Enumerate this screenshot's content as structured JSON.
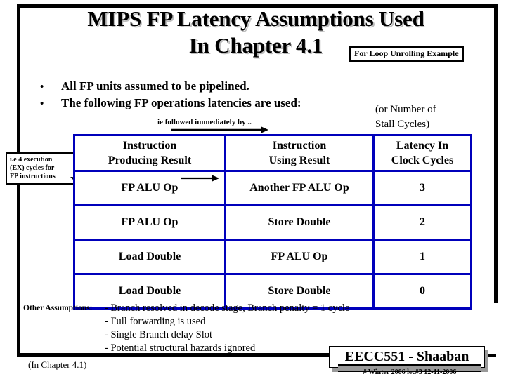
{
  "slide": {
    "title_line_1": "MIPS FP Latency Assumptions Used",
    "title_line_2": "In Chapter 4.1",
    "title_badge": "For Loop Unrolling Example",
    "accent_color": "#0000bb",
    "frame_color": "#000000",
    "shadow_color": "#9a9a9a"
  },
  "bullets": [
    {
      "marker": "•",
      "text": "All FP units assumed to be pipelined."
    },
    {
      "marker": "•",
      "text": "The following  FP operations latencies are used:"
    }
  ],
  "annotations": {
    "stall_note_line_1": "(or Number of",
    "stall_note_line_2": "Stall  Cycles)",
    "ie_note": "ie followed immediately by ..",
    "ex_callout_line_1": "i.e 4 execution",
    "ex_callout_line_2": "(EX) cycles for",
    "ex_callout_line_3": "FP instructions"
  },
  "table": {
    "headers": [
      {
        "line1": "Instruction",
        "line2": "Producing Result"
      },
      {
        "line1": "Instruction",
        "line2": "Using Result"
      },
      {
        "line1": "Latency In",
        "line2": "Clock Cycles"
      }
    ],
    "rows": [
      {
        "producing": "FP ALU Op",
        "using": "Another FP ALU Op",
        "latency": "3"
      },
      {
        "producing": "FP ALU Op",
        "using": "Store Double",
        "latency": "2"
      },
      {
        "producing": "Load Double",
        "using": "FP ALU Op",
        "latency": "1"
      },
      {
        "producing": "Load Double",
        "using": "Store Double",
        "latency": "0"
      }
    ]
  },
  "other_assumptions": {
    "label": "Other Assumptions:",
    "items": [
      "- Branch resolved in decode stage,  Branch penalty = 1 cycle",
      "- Full forwarding is used",
      "- Single Branch delay Slot",
      "- Potential structural hazards ignored"
    ]
  },
  "chapter_note": "(In  Chapter 4.1)",
  "footer": {
    "course": "EECC551 - Shaaban",
    "meta": "# Winter 2006  lec#3   12-11-2006"
  }
}
